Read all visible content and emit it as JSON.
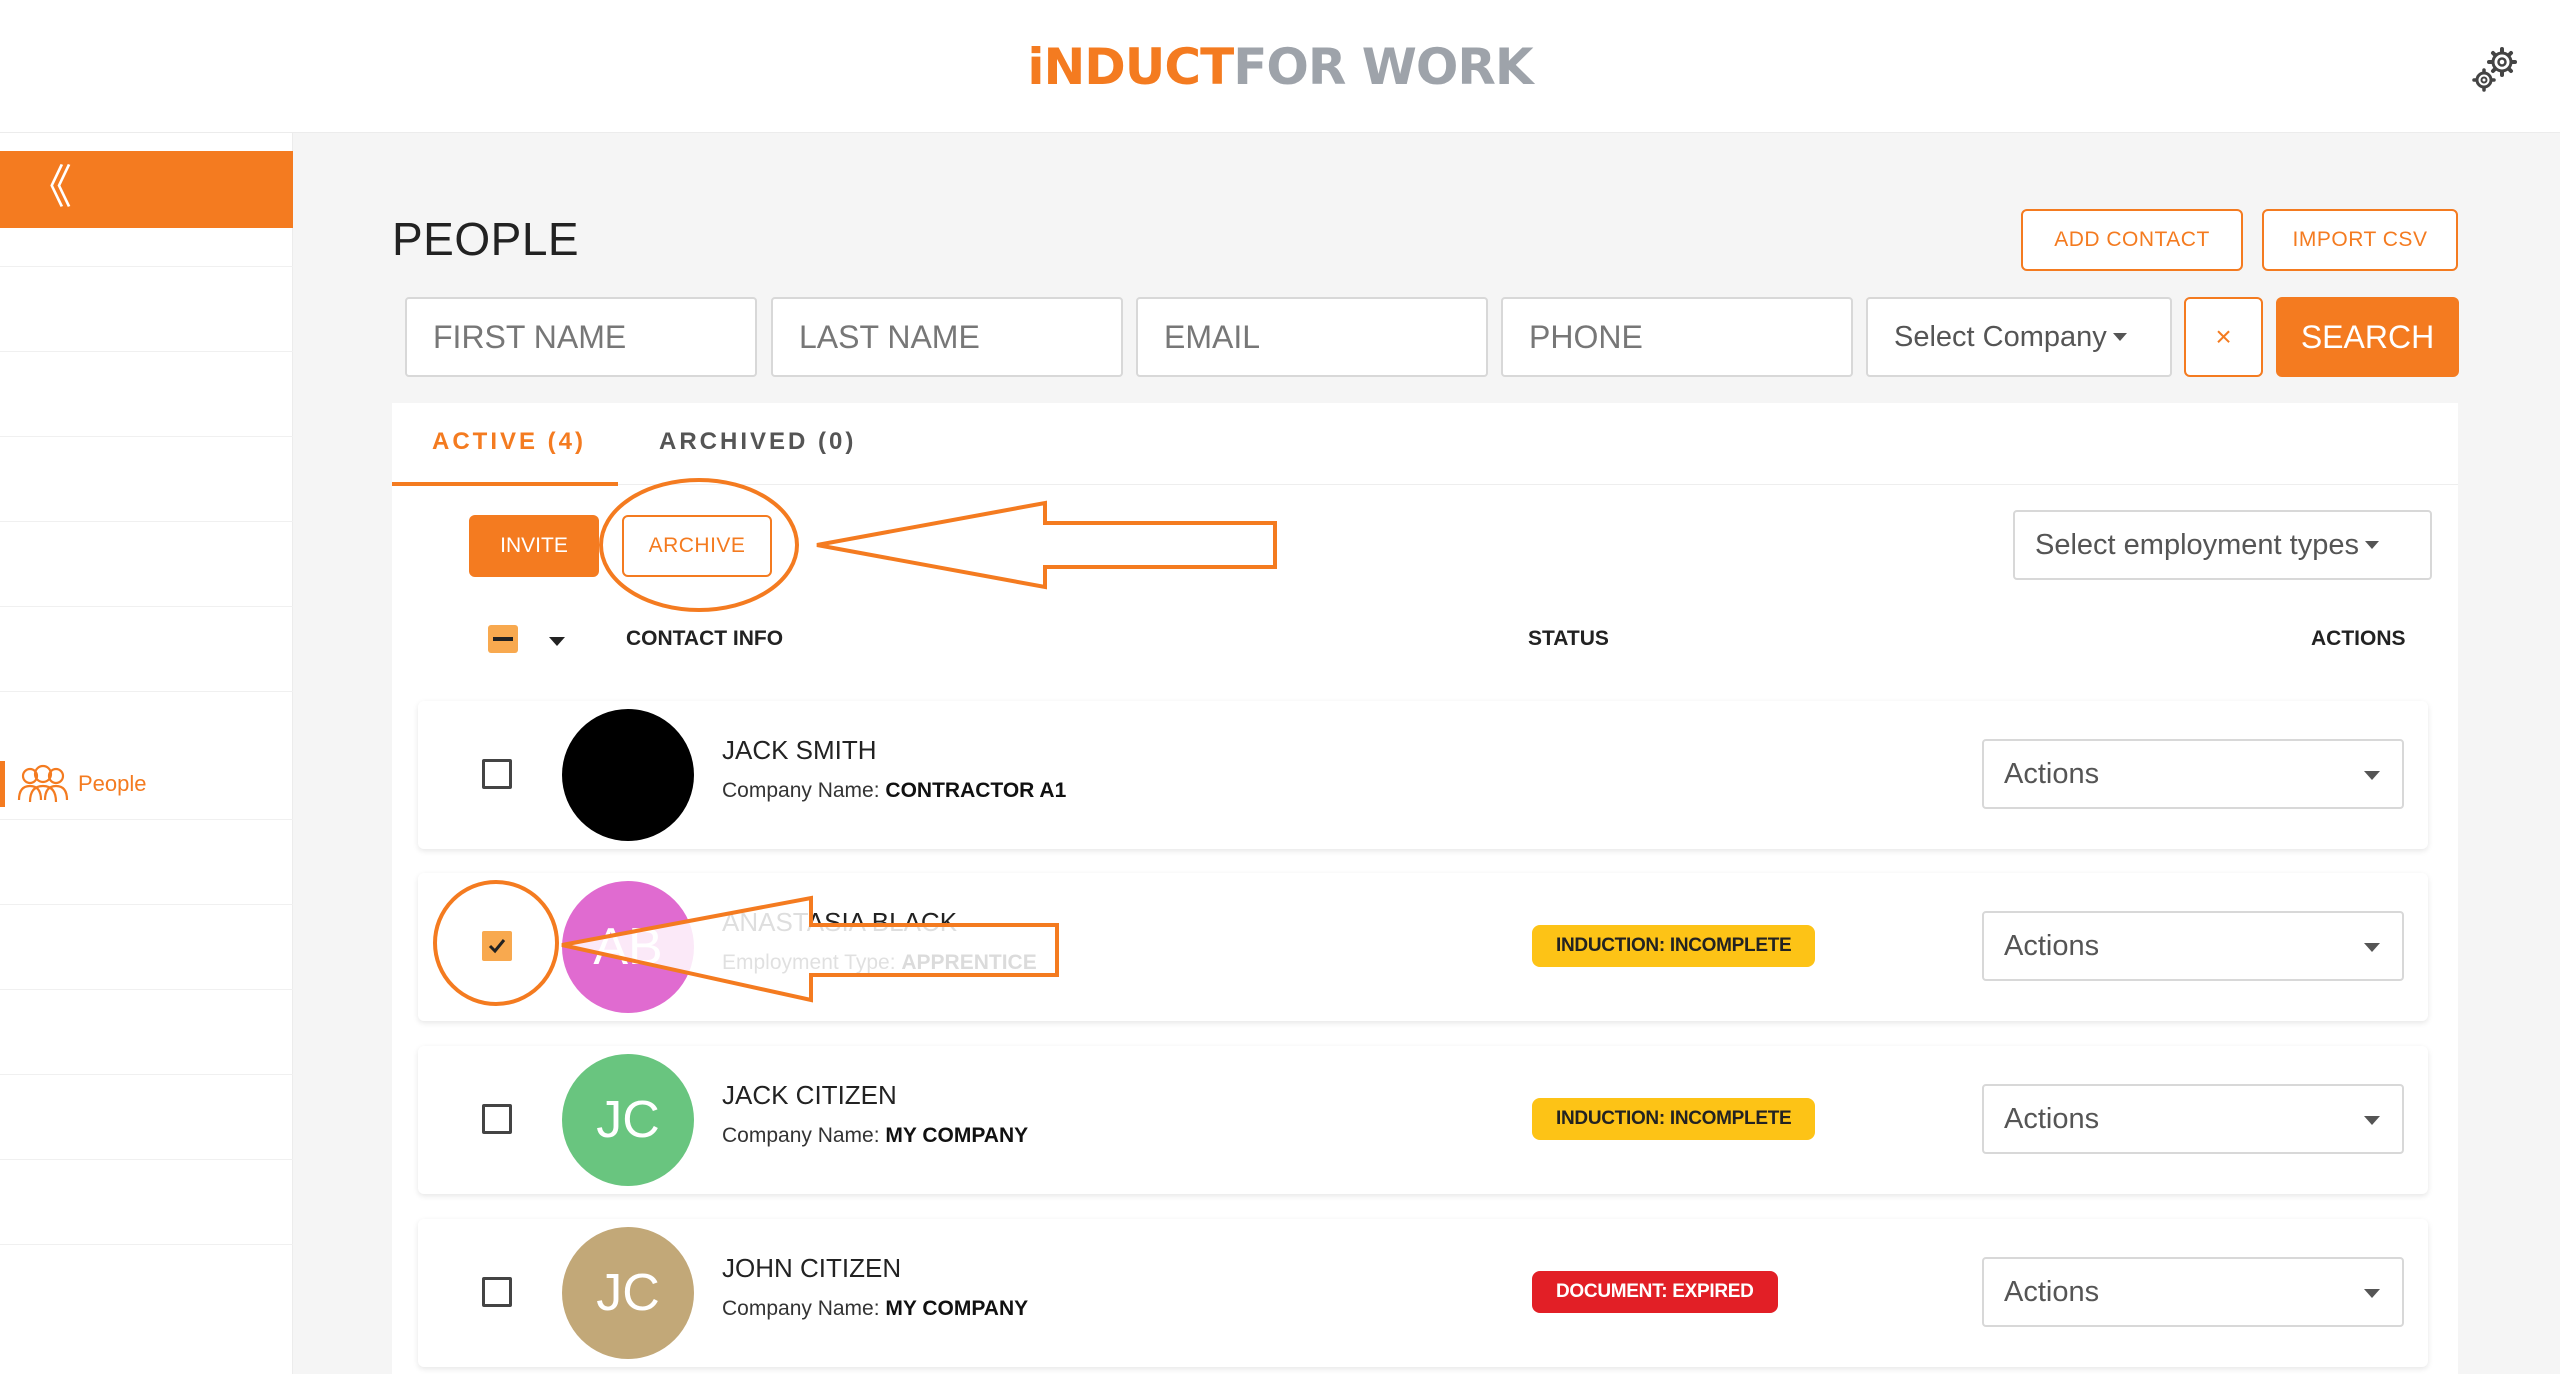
{
  "brand": {
    "logo_part1": "iNDUCT",
    "logo_part2": "FOR WORK",
    "accent": "#f47b20"
  },
  "header": {
    "settings_icon": "gear-icon"
  },
  "sidebar": {
    "collapse_glyph": "《",
    "items": [
      {
        "label": "People",
        "icon": "people-icon",
        "active": true
      }
    ]
  },
  "page": {
    "title": "PEOPLE",
    "add_contact_label": "ADD CONTACT",
    "import_csv_label": "IMPORT CSV"
  },
  "filters": {
    "first_name_placeholder": "FIRST NAME",
    "last_name_placeholder": "LAST NAME",
    "email_placeholder": "EMAIL",
    "phone_placeholder": "PHONE",
    "company_select": "Select Company",
    "clear_label": "×",
    "search_label": "SEARCH"
  },
  "tabs": [
    {
      "label": "ACTIVE (4)",
      "active": true
    },
    {
      "label": "ARCHIVED (0)",
      "active": false
    }
  ],
  "toolbar": {
    "invite_label": "INVITE",
    "archive_label": "ARCHIVE",
    "employment_select": "Select employment types"
  },
  "table": {
    "headers": {
      "contact": "CONTACT INFO",
      "status": "STATUS",
      "actions": "ACTIONS"
    },
    "rows": [
      {
        "name": "JACK SMITH",
        "detail_label": "Company Name: ",
        "detail_value": "CONTRACTOR A1",
        "initials": "",
        "avatar_color": "#000000",
        "status": "",
        "checked": false,
        "actions": "Actions"
      },
      {
        "name": "ANASTASIA BLACK",
        "detail_label": "Employment Type: ",
        "detail_value": "APPRENTICE",
        "initials": "AB",
        "avatar_color": "#e06bd0",
        "status": "INDUCTION: INCOMPLETE",
        "status_type": "incomplete",
        "checked": true,
        "actions": "Actions"
      },
      {
        "name": "JACK CITIZEN",
        "detail_label": "Company Name: ",
        "detail_value": "MY COMPANY",
        "initials": "JC",
        "avatar_color": "#69c57f",
        "status": "INDUCTION: INCOMPLETE",
        "status_type": "incomplete",
        "checked": false,
        "actions": "Actions"
      },
      {
        "name": "JOHN CITIZEN",
        "detail_label": "Company Name: ",
        "detail_value": "MY COMPANY",
        "initials": "JC",
        "avatar_color": "#c2a878",
        "status": "DOCUMENT: EXPIRED",
        "status_type": "expired",
        "checked": false,
        "actions": "Actions"
      }
    ]
  },
  "colors": {
    "incomplete": "#fdc316",
    "expired": "#e21f26",
    "checkbox_checked": "#f8a94f"
  }
}
